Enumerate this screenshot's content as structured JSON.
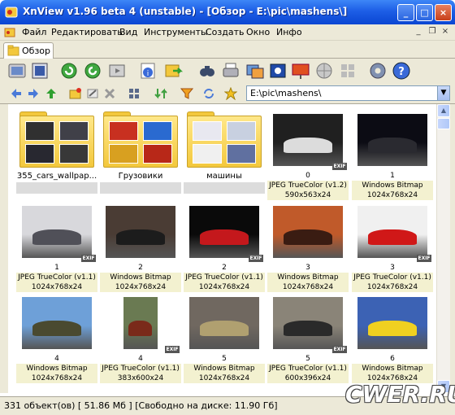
{
  "window": {
    "title": "XnView v1.96 beta 4 (unstable)  - [Обзор - E:\\pic\\mashens\\]",
    "buttons": {
      "minimize": "_",
      "maximize": "□",
      "close": "×"
    }
  },
  "menu": {
    "items": [
      "Файл",
      "Редактировать",
      "Вид",
      "Инструменты",
      "Создать",
      "Окно",
      "Инфо"
    ],
    "mdi": {
      "minimize": "_",
      "restore": "❐",
      "close": "×"
    }
  },
  "tab": {
    "label": "Обзор"
  },
  "toolbar": {
    "icons": [
      "browser-icon",
      "fullscreen-icon",
      "rotate-left-icon",
      "rotate-right-icon",
      "slideshow-icon",
      "info-icon",
      "export-icon",
      "find-icon",
      "print-icon",
      "batch-icon",
      "capture-icon",
      "presentation-icon",
      "web-icon",
      "grid-icon",
      "settings-icon",
      "help-icon"
    ]
  },
  "nav": {
    "address": "E:\\pic\\mashens\\",
    "icons": [
      "back-icon",
      "forward-icon",
      "up-icon",
      "new-folder-icon",
      "rename-icon",
      "delete-icon",
      "view-mode-icon",
      "sort-icon",
      "filter-icon",
      "refresh-icon",
      "favorites-icon"
    ]
  },
  "grid": {
    "items": [
      {
        "kind": "folder",
        "name": "355_cars_wallpap...",
        "theme": "dark"
      },
      {
        "kind": "folder",
        "name": "Грузовики",
        "theme": "trucks"
      },
      {
        "kind": "folder",
        "name": "машины",
        "theme": "cars"
      },
      {
        "kind": "file",
        "rating": "0",
        "type": "JPEG TrueColor (v1.2)",
        "dims": "590x563x24",
        "exif": "EXIF",
        "bg": "#202020",
        "car": "#dcdcdc"
      },
      {
        "kind": "file",
        "rating": "1",
        "type": "Windows Bitmap",
        "dims": "1024x768x24",
        "bg": "#0c0c14",
        "car": "#2a2a30"
      },
      {
        "kind": "file",
        "rating": "1",
        "type": "JPEG TrueColor (v1.1)",
        "dims": "1024x768x24",
        "exif": "EXIF",
        "bg": "#d8d8dc",
        "car": "#505058"
      },
      {
        "kind": "file",
        "rating": "2",
        "type": "Windows Bitmap",
        "dims": "1024x768x24",
        "bg": "#4a3c34",
        "car": "#1c1c1c"
      },
      {
        "kind": "file",
        "rating": "2",
        "type": "JPEG TrueColor (v1.1)",
        "dims": "1024x768x24",
        "exif": "EXIF",
        "bg": "#0a0a0a",
        "car": "#c4181c"
      },
      {
        "kind": "file",
        "rating": "3",
        "type": "Windows Bitmap",
        "dims": "1024x768x24",
        "bg": "#c05a2a",
        "car": "#3a1c12"
      },
      {
        "kind": "file",
        "rating": "3",
        "type": "JPEG TrueColor (v1.1)",
        "dims": "1024x768x24",
        "exif": "EXIF",
        "bg": "#f0f0f0",
        "car": "#d01818"
      },
      {
        "kind": "file",
        "rating": "4",
        "type": "Windows Bitmap",
        "dims": "1024x768x24",
        "bg": "#6ea0d8",
        "car": "#4a4a30"
      },
      {
        "kind": "file",
        "rating": "4",
        "type": "JPEG TrueColor (v1.1)",
        "dims": "383x600x24",
        "exif": "EXIF",
        "bg": "#6a7a52",
        "car": "#7a2a1a",
        "portrait": true
      },
      {
        "kind": "file",
        "rating": "5",
        "type": "Windows Bitmap",
        "dims": "1024x768x24",
        "bg": "#706860",
        "car": "#b0a070"
      },
      {
        "kind": "file",
        "rating": "5",
        "type": "JPEG TrueColor (v1.1)",
        "dims": "600x396x24",
        "exif": "EXIF",
        "bg": "#8a8478",
        "car": "#2a2a2a"
      },
      {
        "kind": "file",
        "rating": "6",
        "type": "Windows Bitmap",
        "dims": "1024x768x24",
        "bg": "#3c62b4",
        "car": "#f0d020"
      }
    ]
  },
  "status": {
    "text": "331 объект(ов) [ 51.86 Мб ] [Свободно на диске: 11.90 Гб]"
  },
  "watermark": "CWER.RU",
  "colors": {
    "titlebar": "#0a46d2",
    "chrome": "#ece9d8",
    "caption_bg": "#f3f1d0"
  }
}
